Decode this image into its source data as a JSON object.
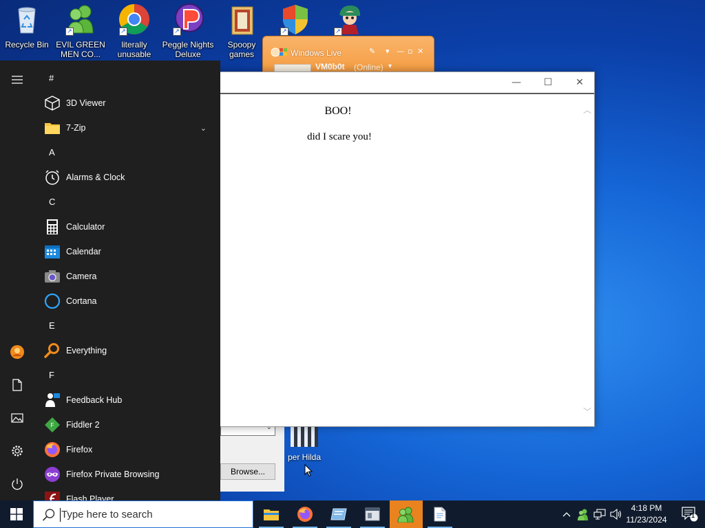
{
  "desktop": {
    "icons": [
      {
        "label": "Recycle Bin",
        "icon": "recycle-bin-icon"
      },
      {
        "label": "EVIL GREEN MEN CO...",
        "icon": "green-men-icon"
      },
      {
        "label": "literally unusable",
        "icon": "chrome-icon"
      },
      {
        "label": "Peggle Nights Deluxe",
        "icon": "peggle-icon"
      },
      {
        "label": "Spoopy games",
        "icon": "folder-icon"
      },
      {
        "label": "",
        "icon": "shield-icon"
      },
      {
        "label": "",
        "icon": "character-icon"
      }
    ],
    "partial_icon_label": "per Hilda"
  },
  "messenger": {
    "title": "Windows Live",
    "username": "VM0b0t",
    "status": "(Online)"
  },
  "background_dialog": {
    "browse_label": "Browse..."
  },
  "main_window": {
    "heading": "BOO!",
    "body": "did I scare you!",
    "minimize": "—",
    "maximize": "☐",
    "close": "✕"
  },
  "start_menu": {
    "sections": [
      {
        "letter": "#",
        "apps": [
          {
            "name": "3D Viewer",
            "icon": "cube-icon"
          },
          {
            "name": "7-Zip",
            "icon": "folder-icon",
            "expandable": true
          }
        ]
      },
      {
        "letter": "A",
        "apps": [
          {
            "name": "Alarms & Clock",
            "icon": "alarm-clock-icon"
          }
        ]
      },
      {
        "letter": "C",
        "apps": [
          {
            "name": "Calculator",
            "icon": "calculator-icon"
          },
          {
            "name": "Calendar",
            "icon": "calendar-icon"
          },
          {
            "name": "Camera",
            "icon": "camera-icon"
          },
          {
            "name": "Cortana",
            "icon": "cortana-icon"
          }
        ]
      },
      {
        "letter": "E",
        "apps": [
          {
            "name": "Everything",
            "icon": "magnifier-icon"
          }
        ]
      },
      {
        "letter": "F",
        "apps": [
          {
            "name": "Feedback Hub",
            "icon": "feedback-icon"
          },
          {
            "name": "Fiddler 2",
            "icon": "fiddler-icon"
          },
          {
            "name": "Firefox",
            "icon": "firefox-icon"
          },
          {
            "name": "Firefox Private Browsing",
            "icon": "firefox-private-icon"
          },
          {
            "name": "Flash Player",
            "icon": "flash-icon"
          }
        ]
      }
    ]
  },
  "taskbar": {
    "search_placeholder": "Type here to search",
    "time": "4:18 PM",
    "date": "11/23/2024",
    "notification_count": "1"
  },
  "colors": {
    "accent": "#e8831f",
    "taskbar": "#101c2e",
    "start_menu": "#1f1f1f"
  }
}
